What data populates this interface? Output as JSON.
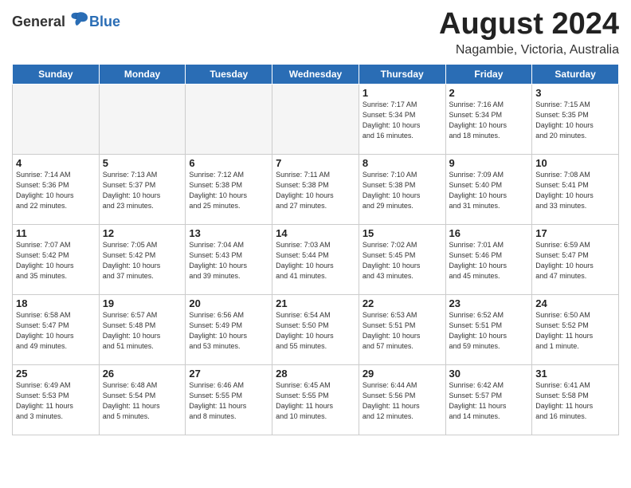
{
  "header": {
    "logo_general": "General",
    "logo_blue": "Blue",
    "month_title": "August 2024",
    "location": "Nagambie, Victoria, Australia"
  },
  "weekdays": [
    "Sunday",
    "Monday",
    "Tuesday",
    "Wednesday",
    "Thursday",
    "Friday",
    "Saturday"
  ],
  "weeks": [
    [
      {
        "day": "",
        "info": ""
      },
      {
        "day": "",
        "info": ""
      },
      {
        "day": "",
        "info": ""
      },
      {
        "day": "",
        "info": ""
      },
      {
        "day": "1",
        "info": "Sunrise: 7:17 AM\nSunset: 5:34 PM\nDaylight: 10 hours\nand 16 minutes."
      },
      {
        "day": "2",
        "info": "Sunrise: 7:16 AM\nSunset: 5:34 PM\nDaylight: 10 hours\nand 18 minutes."
      },
      {
        "day": "3",
        "info": "Sunrise: 7:15 AM\nSunset: 5:35 PM\nDaylight: 10 hours\nand 20 minutes."
      }
    ],
    [
      {
        "day": "4",
        "info": "Sunrise: 7:14 AM\nSunset: 5:36 PM\nDaylight: 10 hours\nand 22 minutes."
      },
      {
        "day": "5",
        "info": "Sunrise: 7:13 AM\nSunset: 5:37 PM\nDaylight: 10 hours\nand 23 minutes."
      },
      {
        "day": "6",
        "info": "Sunrise: 7:12 AM\nSunset: 5:38 PM\nDaylight: 10 hours\nand 25 minutes."
      },
      {
        "day": "7",
        "info": "Sunrise: 7:11 AM\nSunset: 5:38 PM\nDaylight: 10 hours\nand 27 minutes."
      },
      {
        "day": "8",
        "info": "Sunrise: 7:10 AM\nSunset: 5:38 PM\nDaylight: 10 hours\nand 29 minutes."
      },
      {
        "day": "9",
        "info": "Sunrise: 7:09 AM\nSunset: 5:40 PM\nDaylight: 10 hours\nand 31 minutes."
      },
      {
        "day": "10",
        "info": "Sunrise: 7:08 AM\nSunset: 5:41 PM\nDaylight: 10 hours\nand 33 minutes."
      }
    ],
    [
      {
        "day": "11",
        "info": "Sunrise: 7:07 AM\nSunset: 5:42 PM\nDaylight: 10 hours\nand 35 minutes."
      },
      {
        "day": "12",
        "info": "Sunrise: 7:05 AM\nSunset: 5:42 PM\nDaylight: 10 hours\nand 37 minutes."
      },
      {
        "day": "13",
        "info": "Sunrise: 7:04 AM\nSunset: 5:43 PM\nDaylight: 10 hours\nand 39 minutes."
      },
      {
        "day": "14",
        "info": "Sunrise: 7:03 AM\nSunset: 5:44 PM\nDaylight: 10 hours\nand 41 minutes."
      },
      {
        "day": "15",
        "info": "Sunrise: 7:02 AM\nSunset: 5:45 PM\nDaylight: 10 hours\nand 43 minutes."
      },
      {
        "day": "16",
        "info": "Sunrise: 7:01 AM\nSunset: 5:46 PM\nDaylight: 10 hours\nand 45 minutes."
      },
      {
        "day": "17",
        "info": "Sunrise: 6:59 AM\nSunset: 5:47 PM\nDaylight: 10 hours\nand 47 minutes."
      }
    ],
    [
      {
        "day": "18",
        "info": "Sunrise: 6:58 AM\nSunset: 5:47 PM\nDaylight: 10 hours\nand 49 minutes."
      },
      {
        "day": "19",
        "info": "Sunrise: 6:57 AM\nSunset: 5:48 PM\nDaylight: 10 hours\nand 51 minutes."
      },
      {
        "day": "20",
        "info": "Sunrise: 6:56 AM\nSunset: 5:49 PM\nDaylight: 10 hours\nand 53 minutes."
      },
      {
        "day": "21",
        "info": "Sunrise: 6:54 AM\nSunset: 5:50 PM\nDaylight: 10 hours\nand 55 minutes."
      },
      {
        "day": "22",
        "info": "Sunrise: 6:53 AM\nSunset: 5:51 PM\nDaylight: 10 hours\nand 57 minutes."
      },
      {
        "day": "23",
        "info": "Sunrise: 6:52 AM\nSunset: 5:51 PM\nDaylight: 10 hours\nand 59 minutes."
      },
      {
        "day": "24",
        "info": "Sunrise: 6:50 AM\nSunset: 5:52 PM\nDaylight: 11 hours\nand 1 minute."
      }
    ],
    [
      {
        "day": "25",
        "info": "Sunrise: 6:49 AM\nSunset: 5:53 PM\nDaylight: 11 hours\nand 3 minutes."
      },
      {
        "day": "26",
        "info": "Sunrise: 6:48 AM\nSunset: 5:54 PM\nDaylight: 11 hours\nand 5 minutes."
      },
      {
        "day": "27",
        "info": "Sunrise: 6:46 AM\nSunset: 5:55 PM\nDaylight: 11 hours\nand 8 minutes."
      },
      {
        "day": "28",
        "info": "Sunrise: 6:45 AM\nSunset: 5:55 PM\nDaylight: 11 hours\nand 10 minutes."
      },
      {
        "day": "29",
        "info": "Sunrise: 6:44 AM\nSunset: 5:56 PM\nDaylight: 11 hours\nand 12 minutes."
      },
      {
        "day": "30",
        "info": "Sunrise: 6:42 AM\nSunset: 5:57 PM\nDaylight: 11 hours\nand 14 minutes."
      },
      {
        "day": "31",
        "info": "Sunrise: 6:41 AM\nSunset: 5:58 PM\nDaylight: 11 hours\nand 16 minutes."
      }
    ]
  ]
}
